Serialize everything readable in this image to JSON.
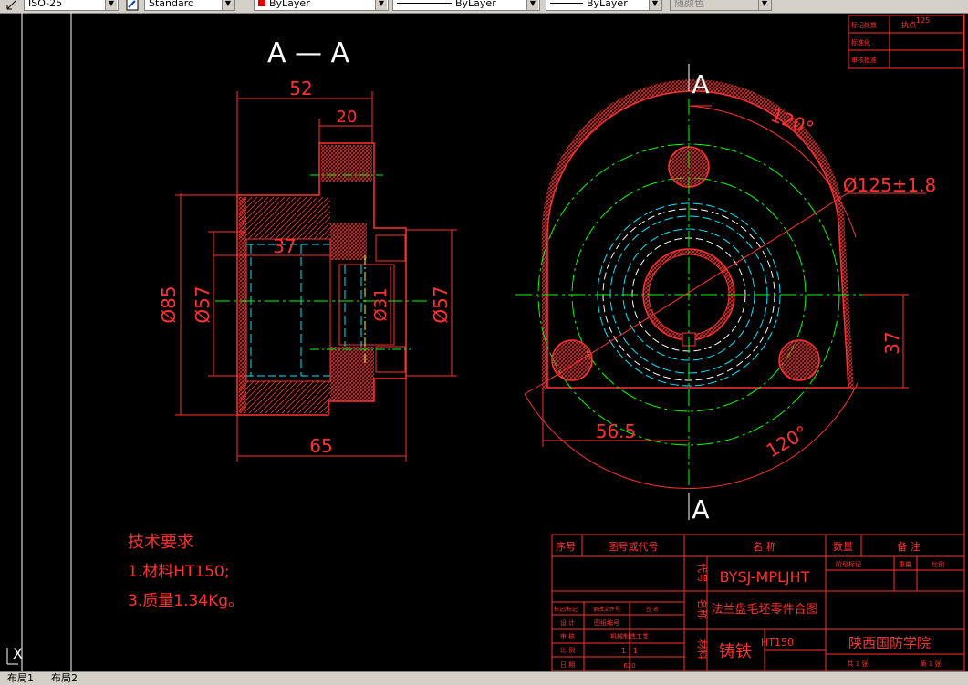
{
  "toolbar": {
    "dimstyle": "ISO-25",
    "textstyle": "Standard",
    "layer_color": "ByLayer",
    "linetype": "ByLayer",
    "lineweight": "ByLayer",
    "plotstyle": "随颜色"
  },
  "section": {
    "title": "A — A",
    "dims": {
      "d52": "52",
      "d20": "20",
      "d37": "37",
      "d65": "65",
      "phi85": "Ø85",
      "phi57_left": "Ø57",
      "phi31": "Ø31",
      "phi57_right": "Ø57"
    }
  },
  "front": {
    "cut_top": "A",
    "cut_bottom": "A",
    "dims": {
      "angle_top": "120°",
      "angle_bottom": "120°",
      "phi125": "Ø125±1.8",
      "d56": "56.5",
      "d37": "37"
    }
  },
  "notes": {
    "title": "技术要求",
    "line1": "1.材料HT150;",
    "line2": "3.质量1.34Kg。"
  },
  "revision_box": {
    "r1": "标记处数",
    "r1b": "执点",
    "r1c": "125",
    "r2": "标准化",
    "r3": "审核批准"
  },
  "title_block": {
    "col_seq": "序号",
    "col_code": "图号或代号",
    "col_name": "名 称",
    "col_qty": "数量",
    "col_note": "备 注",
    "label_code": "代号",
    "label_name": "名称",
    "label_material": "材料",
    "drawing_code": "BYSJ-MPLJHT",
    "drawing_name": "法兰盘毛坯零件合图",
    "material": "铸铁",
    "material_grade": "HT150",
    "school": "陕西国防学院",
    "sign_mark": "标记/标记",
    "sign_docno": "更改文件号",
    "sign_sig": "签 名",
    "sign_design": "设 计",
    "sign_check": "审 核",
    "sign_scale": "比 例",
    "sign_date": "日 期",
    "design_name": "图纸编号",
    "check_name": "机械制造工艺",
    "scale": "1 : 1",
    "date": "620",
    "stage": "阶段标记",
    "weight": "重量",
    "ratio": "比例",
    "sheet_total": "共 1 张",
    "sheet_no": "第 1 张"
  },
  "tabs": [
    "布局1",
    "布局2"
  ]
}
